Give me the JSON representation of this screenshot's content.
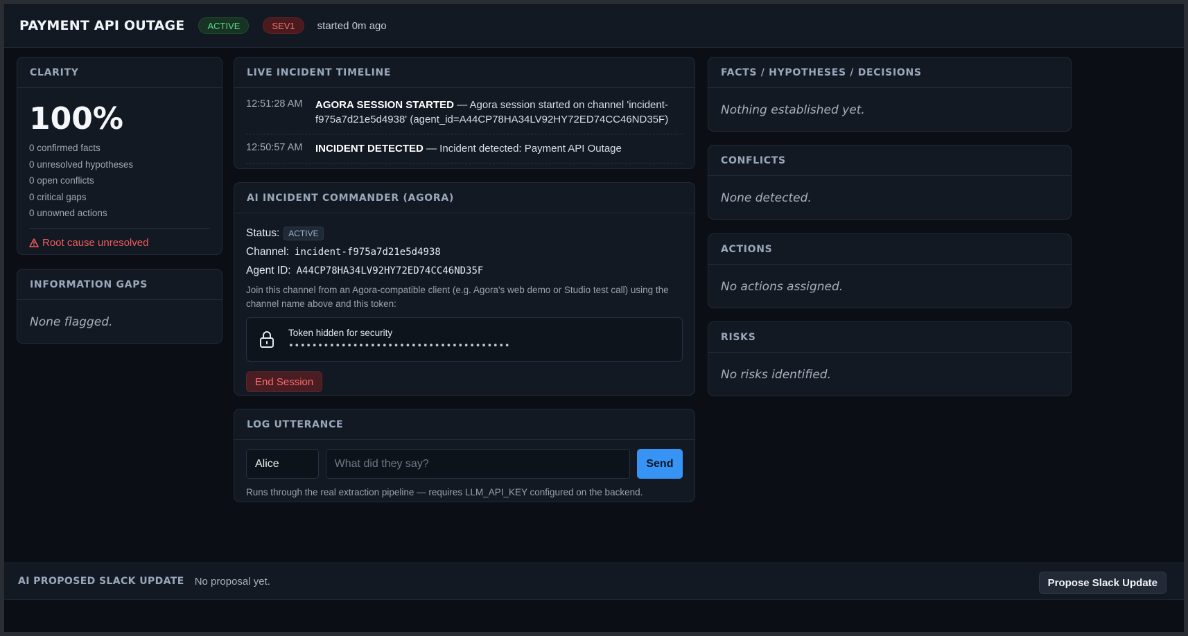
{
  "header": {
    "title": "PAYMENT API OUTAGE",
    "status_badge": "ACTIVE",
    "severity_badge": "SEV1",
    "started": "started 0m ago"
  },
  "clarity": {
    "title": "CLARITY",
    "percent": "100%",
    "stats": [
      "0 confirmed facts",
      "0 unresolved hypotheses",
      "0 open conflicts",
      "0 critical gaps",
      "0 unowned actions"
    ],
    "warning": "Root cause unresolved"
  },
  "info_gaps": {
    "title": "INFORMATION GAPS",
    "empty": "None flagged."
  },
  "timeline": {
    "title": "LIVE INCIDENT TIMELINE",
    "events": [
      {
        "time": "12:51:28 AM",
        "label": "AGORA SESSION STARTED",
        "text": " — Agora session started on channel 'incident-f975a7d21e5d4938' (agent_id=A44CP78HA34LV92HY72ED74CC46ND35F)"
      },
      {
        "time": "12:50:57 AM",
        "label": "INCIDENT DETECTED",
        "text": " — Incident detected: Payment API Outage"
      }
    ]
  },
  "commander": {
    "title": "AI INCIDENT COMMANDER (AGORA)",
    "status_label": "Status:",
    "status_value": "ACTIVE",
    "channel_label": "Channel:",
    "channel_value": "incident-f975a7d21e5d4938",
    "agent_label": "Agent ID:",
    "agent_value": "A44CP78HA34LV92HY72ED74CC46ND35F",
    "hint": "Join this channel from an Agora-compatible client (e.g. Agora's web demo or Studio test call) using the channel name  above and this token:",
    "token_label": "Token hidden for security",
    "token_mask": "••••••••••••••••••••••••••••••••••••••",
    "end_button": "End Session"
  },
  "log": {
    "title": "LOG UTTERANCE",
    "speaker": "Alice",
    "placeholder": "What did they say?",
    "send_button": "Send",
    "hint": "Runs through the real extraction pipeline — requires LLM_API_KEY configured on the backend."
  },
  "facts": {
    "title": "FACTS / HYPOTHESES / DECISIONS",
    "empty": "Nothing established yet."
  },
  "conflicts": {
    "title": "CONFLICTS",
    "empty": "None detected."
  },
  "actions": {
    "title": "ACTIONS",
    "empty": "No actions assigned."
  },
  "risks": {
    "title": "RISKS",
    "empty": "No risks identified."
  },
  "footer": {
    "label": "AI PROPOSED SLACK UPDATE",
    "value": "No proposal yet.",
    "button": "Propose Slack Update"
  },
  "colors": {
    "background": "#0b0f15",
    "panel": "#121923",
    "accent": "#3794f5",
    "danger": "#ef5b5b",
    "success": "#5fd98a"
  },
  "icons": [
    "warning-icon",
    "lock-icon"
  ]
}
